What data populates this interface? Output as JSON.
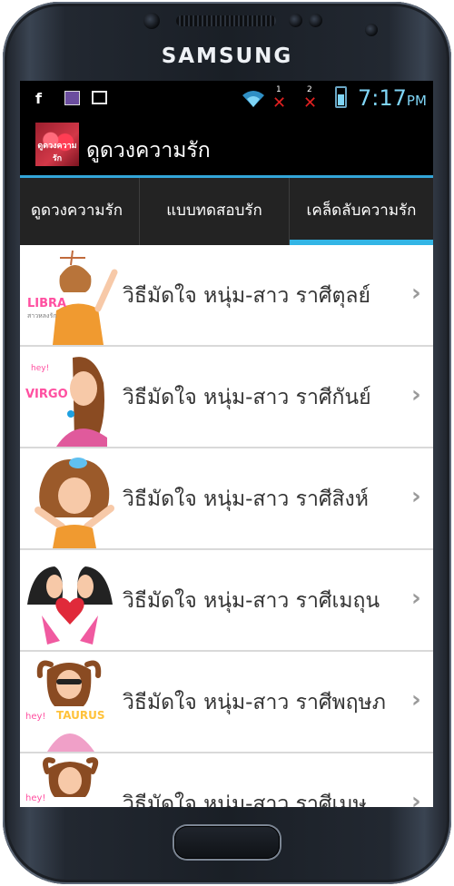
{
  "device": {
    "brand": "SAMSUNG"
  },
  "status_bar": {
    "time": "7:17",
    "ampm": "PM",
    "sim1": "1",
    "sim2": "2"
  },
  "action_bar": {
    "title": "ดูดวงความรัก",
    "app_icon_label": "ดูดวงความรัก"
  },
  "tabs": [
    {
      "label": "ดูดวงความรัก",
      "selected": false
    },
    {
      "label": "แบบทดสอบรัก",
      "selected": false
    },
    {
      "label": "เคล็ดลับความรัก",
      "selected": true
    }
  ],
  "list": {
    "items": [
      {
        "title": "วิธีมัดใจ หนุ่ม-สาว ราศีตุลย์",
        "thumb_label": "LIBRA",
        "thumb_sub": "สาวหลงรัก"
      },
      {
        "title": "วิธีมัดใจ หนุ่ม-สาว ราศีกันย์",
        "thumb_label": "VIRGO",
        "thumb_sub": "hey!"
      },
      {
        "title": "วิธีมัดใจ หนุ่ม-สาว ราศีสิงห์",
        "thumb_label": "",
        "thumb_sub": ""
      },
      {
        "title": "วิธีมัดใจ หนุ่ม-สาว ราศีเมถุน",
        "thumb_label": "",
        "thumb_sub": ""
      },
      {
        "title": "วิธีมัดใจ หนุ่ม-สาว ราศีพฤษภ",
        "thumb_label": "TAURUS",
        "thumb_sub": "hey!"
      },
      {
        "title": "วิธีมัดใจ หนุ่ม-สาว ราศีเมษ",
        "thumb_label": "",
        "thumb_sub": "hey!"
      }
    ],
    "chevron": "›"
  },
  "colors": {
    "accent": "#33b5e5",
    "status_text": "#7fd5f6",
    "tab_bg": "#232323"
  }
}
